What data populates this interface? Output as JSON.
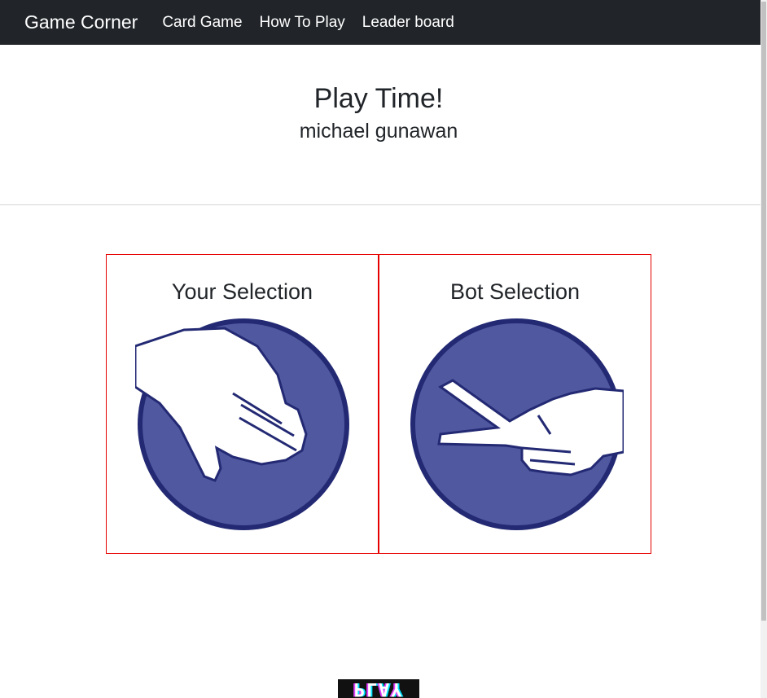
{
  "nav": {
    "brand": "Game Corner",
    "links": [
      "Card Game",
      "How To Play",
      "Leader board"
    ]
  },
  "header": {
    "title": "Play Time!",
    "player_name": "michael gunawan"
  },
  "selections": {
    "player": {
      "label": "Your Selection",
      "choice_icon": "paper-hand-icon"
    },
    "bot": {
      "label": "Bot Selection",
      "choice_icon": "scissors-hand-icon"
    }
  },
  "footer": {
    "play_logo": "PLAY"
  },
  "colors": {
    "navbar": "#212529",
    "card_border": "#e60000",
    "circle_fill": "#5058a0",
    "circle_border": "#232a73"
  }
}
